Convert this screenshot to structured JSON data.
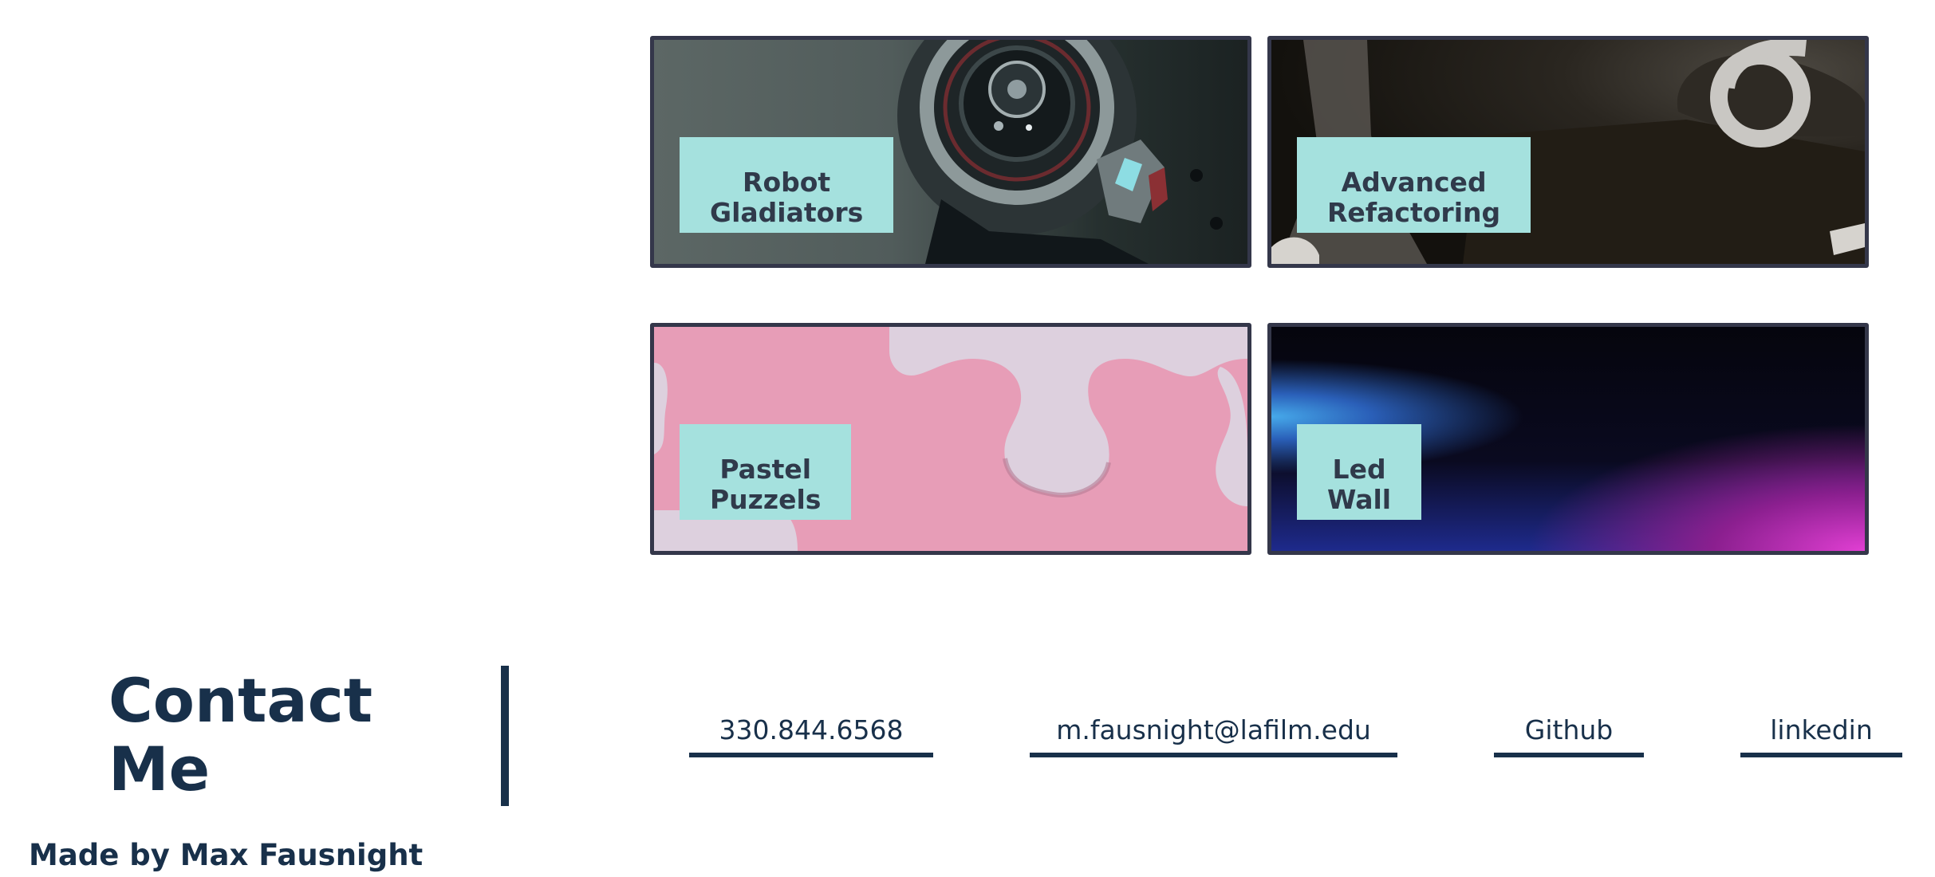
{
  "projects": [
    {
      "id": "robot",
      "title": "Robot\nGladiators",
      "art": "robot-helmet-image"
    },
    {
      "id": "refactor",
      "title": "Advanced\nRefactoring",
      "art": "keyboard-key-image"
    },
    {
      "id": "puzzle",
      "title": "Pastel\nPuzzels",
      "art": "puzzle-piece-image"
    },
    {
      "id": "led",
      "title": "Led\nWall",
      "art": "led-glow-image"
    }
  ],
  "contact": {
    "title": "Contact\nMe",
    "links": {
      "phone": "330.844.6568",
      "email": "m.fausnight@lafilm.edu",
      "github": "Github",
      "linkedin": "linkedin"
    }
  },
  "footer": {
    "credit": "Made by Max Fausnight"
  },
  "colors": {
    "navy": "#18304a",
    "label_bg": "#a5e1de",
    "card_border": "#34374a"
  }
}
